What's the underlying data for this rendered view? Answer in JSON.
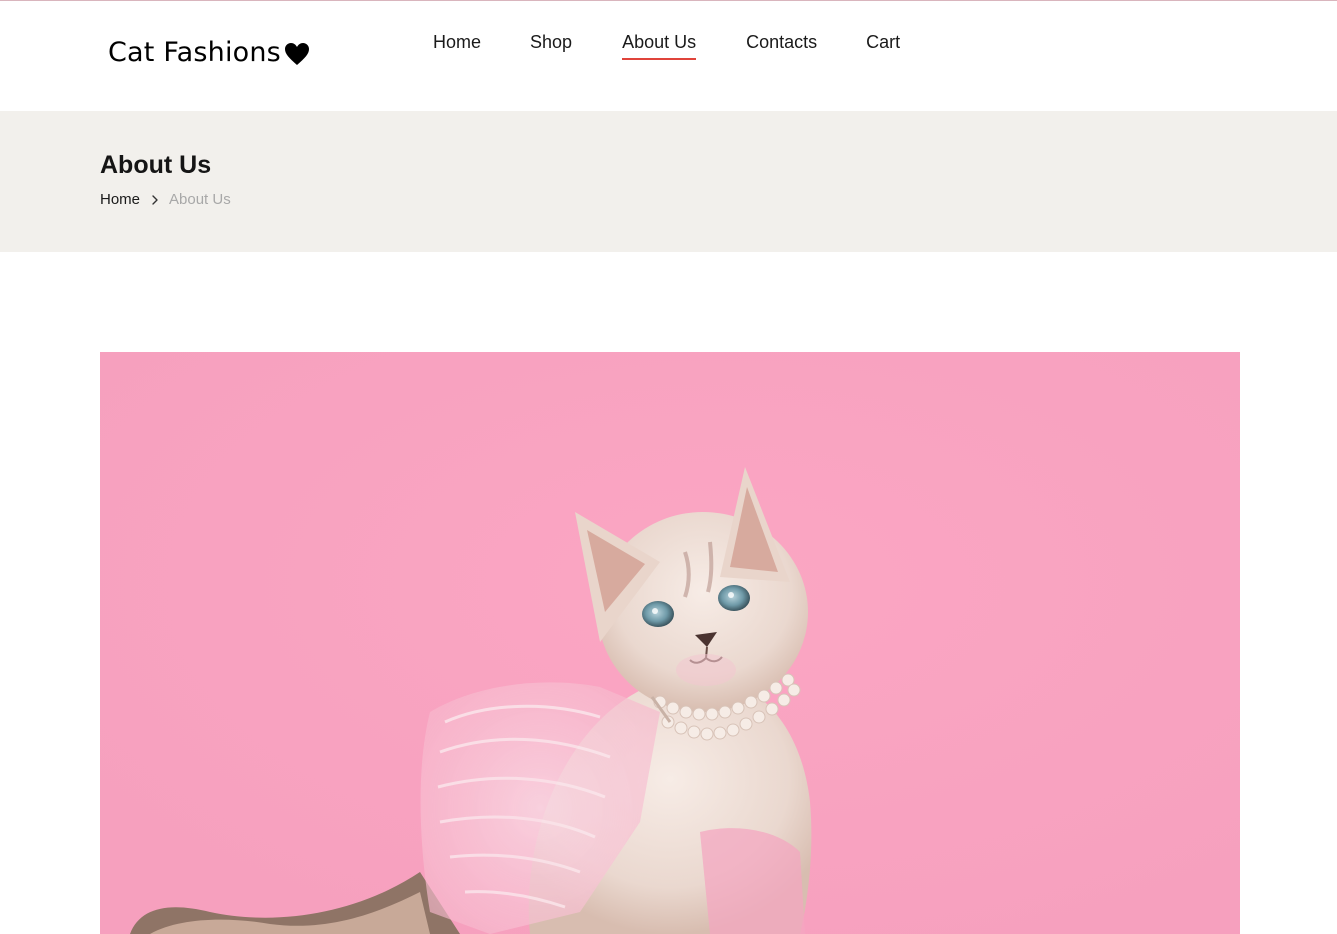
{
  "brand": {
    "name": "Cat Fashions",
    "icon": "heart-icon"
  },
  "nav": {
    "items": [
      {
        "label": "Home",
        "active": false
      },
      {
        "label": "Shop",
        "active": false
      },
      {
        "label": "About Us",
        "active": true
      },
      {
        "label": "Contacts",
        "active": false
      },
      {
        "label": "Cart",
        "active": false
      }
    ]
  },
  "page_header": {
    "title": "About Us",
    "breadcrumb": {
      "home": "Home",
      "separator_icon": "chevron-right-icon",
      "current": "About Us"
    }
  },
  "hero": {
    "subject": "kitten-in-tutu-photo"
  },
  "colors": {
    "accent": "#e0443b",
    "band_background": "#f2f0ec",
    "hero_background": "#f8a3c0",
    "breadcrumb_muted": "#a8a8a8"
  }
}
